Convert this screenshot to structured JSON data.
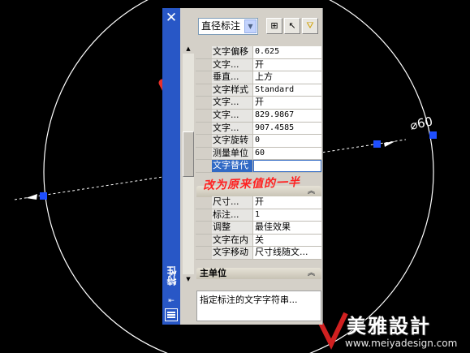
{
  "palette": {
    "title": "特性",
    "close_glyph": "✕",
    "object_type": "直径标注",
    "help_text": "指定标注的文字字符串..."
  },
  "properties": [
    {
      "key": "文字偏移",
      "value": "0.625"
    },
    {
      "key": "文字...",
      "value": "开"
    },
    {
      "key": "垂直...",
      "value": "上方"
    },
    {
      "key": "文字样式",
      "value": "Standard"
    },
    {
      "key": "文字...",
      "value": "开"
    },
    {
      "key": "文字...",
      "value": "829.9867"
    },
    {
      "key": "文字...",
      "value": "907.4585"
    },
    {
      "key": "文字旋转",
      "value": "0"
    },
    {
      "key": "测量单位",
      "value": "60"
    },
    {
      "key": "文字替代",
      "value": ""
    }
  ],
  "fit_section_rows": [
    {
      "key": "尺寸...",
      "value": "开"
    },
    {
      "key": "标注...",
      "value": "1"
    },
    {
      "key": "调整",
      "value": "最佳效果"
    },
    {
      "key": "文字在内",
      "value": "关"
    },
    {
      "key": "文字移动",
      "value": "尺寸线随文..."
    }
  ],
  "sections": {
    "primary_units": "主单位"
  },
  "annotation": "改为原来值的一半",
  "dimension_text": "⌀60",
  "watermark": {
    "brand": "美雅設計",
    "url": "www.meiyadesign.com"
  },
  "icons": [
    "quick-select-icon",
    "select-objects-icon",
    "pickadd-filter-icon"
  ],
  "colors": {
    "accent": "#2857c6",
    "annotation": "#ff2020",
    "selection": "#316ac5",
    "grip": "#1f4fff"
  }
}
